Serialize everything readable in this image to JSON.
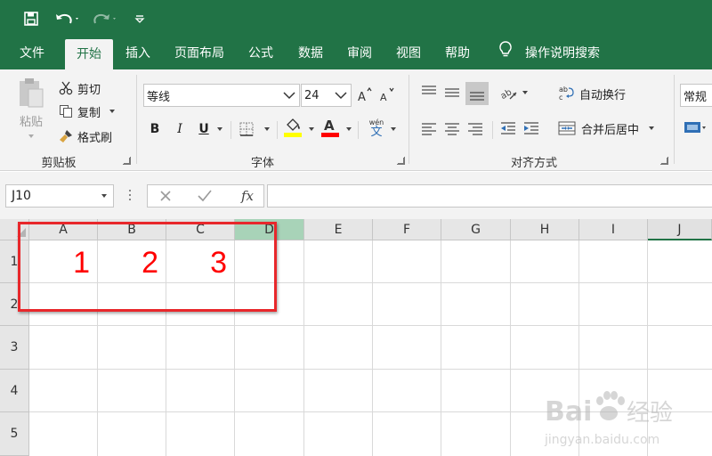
{
  "tabs": [
    {
      "label": "文件",
      "active": false
    },
    {
      "label": "开始",
      "active": true
    },
    {
      "label": "插入",
      "active": false
    },
    {
      "label": "页面布局",
      "active": false
    },
    {
      "label": "公式",
      "active": false
    },
    {
      "label": "数据",
      "active": false
    },
    {
      "label": "审阅",
      "active": false
    },
    {
      "label": "视图",
      "active": false
    },
    {
      "label": "帮助",
      "active": false
    }
  ],
  "search_label": "操作说明搜索",
  "clipboard": {
    "paste": "粘贴",
    "cut": "剪切",
    "copy": "复制",
    "format_painter": "格式刷",
    "group_label": "剪贴板"
  },
  "font": {
    "name": "等线",
    "size": "24",
    "bold": "B",
    "italic": "I",
    "underline": "U",
    "wen": "wén",
    "wen_char": "文",
    "group_label": "字体"
  },
  "alignment": {
    "wrap_text": "自动换行",
    "merge_center": "合并后居中",
    "group_label": "对齐方式"
  },
  "number": {
    "format": "常规"
  },
  "formula_bar": {
    "name_box": "J10",
    "fx": "fx",
    "formula": ""
  },
  "grid": {
    "columns": [
      "A",
      "B",
      "C",
      "D",
      "E",
      "F",
      "G",
      "H",
      "I",
      "J"
    ],
    "rows": [
      "1",
      "2",
      "3",
      "4",
      "5"
    ],
    "cells": [
      {
        "ref": "A1",
        "value": "1"
      },
      {
        "ref": "B1",
        "value": "2"
      },
      {
        "ref": "C1",
        "value": "3"
      }
    ]
  },
  "colors": {
    "excel_green": "#217346",
    "cell_text": "#ff0000",
    "annotation": "#e8272b"
  },
  "watermark": {
    "brand": "Bai",
    "suffix": "经验",
    "url": "jingyan.baidu.com"
  }
}
